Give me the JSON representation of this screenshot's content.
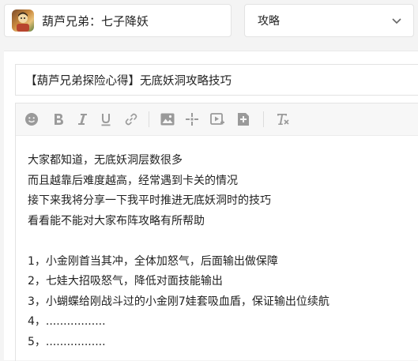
{
  "game": {
    "name": "葫芦兄弟：七子降妖",
    "icon": "game-app-icon"
  },
  "category": {
    "selected": "攻略",
    "icon": "chevron-down-icon"
  },
  "post": {
    "title": "【葫芦兄弟探险心得】无底妖洞攻略技巧",
    "toolbar": [
      {
        "name": "emoji-icon"
      },
      {
        "name": "bold-icon"
      },
      {
        "name": "italic-icon"
      },
      {
        "name": "underline-icon"
      },
      {
        "name": "link-icon"
      },
      {
        "name": "image-icon"
      },
      {
        "name": "move-icon"
      },
      {
        "name": "video-icon"
      },
      {
        "name": "insert-icon"
      },
      {
        "name": "clear-format-icon"
      }
    ],
    "body_lines": [
      "大家都知道，无底妖洞层数很多",
      "而且越靠后难度越高，经常遇到卡关的情况",
      "接下来我将分享一下我平时推进无底妖洞时的技巧",
      "看看能不能对大家布阵攻略有所帮助",
      "",
      "1，小金刚首当其冲，全体加怒气，后面输出做保障",
      "2，七娃大招吸怒气，降低对面技能输出",
      "3，小蝴蝶给刚战斗过的小金刚7娃套吸血盾，保证输出位续航",
      "4，.................",
      "5，................."
    ]
  },
  "colors": {
    "icon_gray": "#9a9a9a",
    "border": "#e3e3e3",
    "toolbar_bg": "#f7f7f7"
  }
}
